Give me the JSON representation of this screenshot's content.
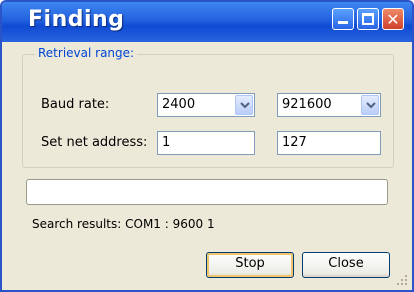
{
  "window": {
    "title": "Finding"
  },
  "retrieval": {
    "legend": "Retrieval range:",
    "baud_label": "Baud rate:",
    "baud_from": "2400",
    "baud_to": "921600",
    "address_label": "Set net address:",
    "address_from": "1",
    "address_to": "127"
  },
  "search": {
    "progress": "",
    "results_label": "Search results:",
    "results_value": "COM1 : 9600 1"
  },
  "buttons": {
    "stop": "Stop",
    "close": "Close"
  },
  "colors": {
    "title_bar": "#2462df",
    "legend_text": "#0046d5",
    "dialog_bg": "#ece9d8"
  }
}
